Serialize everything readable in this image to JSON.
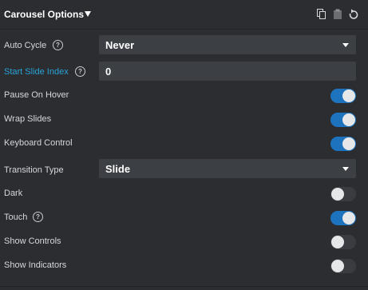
{
  "header": {
    "title": "Carousel Options",
    "icons": [
      "copy-icon",
      "paste-icon",
      "reset-icon"
    ]
  },
  "rows": {
    "auto_cycle": {
      "label": "Auto Cycle",
      "value": "Never",
      "help": "?"
    },
    "start_slide_index": {
      "label": "Start Slide Index",
      "value": "0",
      "help": "?",
      "label_color": "#29a3d8"
    },
    "pause_on_hover": {
      "label": "Pause On Hover",
      "on": true
    },
    "wrap_slides": {
      "label": "Wrap Slides",
      "on": true
    },
    "keyboard_control": {
      "label": "Keyboard Control",
      "on": true
    },
    "transition_type": {
      "label": "Transition Type",
      "value": "Slide"
    },
    "dark": {
      "label": "Dark",
      "on": false
    },
    "touch": {
      "label": "Touch",
      "on": true,
      "help": "?"
    },
    "show_controls": {
      "label": "Show Controls",
      "on": false
    },
    "show_indicators": {
      "label": "Show Indicators",
      "on": false
    }
  },
  "colors": {
    "background": "#2b2d31",
    "field": "#3c3f44",
    "toggle_on": "#1e73be",
    "toggle_off": "#3a3c41",
    "accent": "#29a3d8"
  }
}
